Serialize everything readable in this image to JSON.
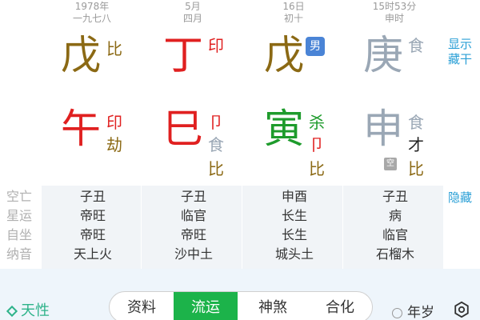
{
  "columns": [
    {
      "date1": "1978年",
      "date2": "一九七八",
      "stem": "戊",
      "stem_color": "#8b6914",
      "stem_god": "比",
      "stem_god_color": "#8b6914",
      "branch": "午",
      "branch_color": "#e02020",
      "hidden": [
        {
          "text": "印",
          "color": "#e02020"
        },
        {
          "text": "劫",
          "color": "#8b6914"
        }
      ]
    },
    {
      "date1": "5月",
      "date2": "四月",
      "stem": "丁",
      "stem_color": "#e02020",
      "stem_god": "印",
      "stem_god_color": "#e02020",
      "branch": "巳",
      "branch_color": "#e02020",
      "hidden": [
        {
          "text": "卩",
          "color": "#e02020"
        },
        {
          "text": "食",
          "color": "#9aa7b5"
        },
        {
          "text": "比",
          "color": "#8b6914"
        }
      ]
    },
    {
      "date1": "16日",
      "date2": "初十",
      "stem": "戊",
      "stem_color": "#8b6914",
      "stem_god": "男",
      "stem_god_color": "#ffffff",
      "branch": "寅",
      "branch_color": "#1e9b2c",
      "hidden": [
        {
          "text": "杀",
          "color": "#1e9b2c"
        },
        {
          "text": "卩",
          "color": "#e02020"
        },
        {
          "text": "比",
          "color": "#8b6914"
        }
      ]
    },
    {
      "date1": "15时53分",
      "date2": "申时",
      "stem": "庚",
      "stem_color": "#9aa7b5",
      "stem_god": "食",
      "stem_god_color": "#9aa7b5",
      "branch": "申",
      "branch_color": "#9aa7b5",
      "hidden": [
        {
          "text": "食",
          "color": "#9aa7b5"
        },
        {
          "text": "才",
          "color": "#222222"
        },
        {
          "text": "比",
          "color": "#8b6914"
        }
      ],
      "kong_badge": "空"
    }
  ],
  "side": {
    "show_label_1": "显示",
    "show_label_2": "藏干",
    "hide_label": "隐藏"
  },
  "table": {
    "labels": [
      "空亡",
      "星运",
      "自坐",
      "纳音"
    ],
    "rows": [
      [
        "子丑",
        "子丑",
        "申酉",
        "子丑"
      ],
      [
        "帝旺",
        "临官",
        "长生",
        "病"
      ],
      [
        "帝旺",
        "帝旺",
        "长生",
        "临官"
      ],
      [
        "天上火",
        "沙中土",
        "城头土",
        "石榴木"
      ]
    ]
  },
  "bottom": {
    "tianxing": "天性",
    "tabs": [
      "资料",
      "流运",
      "神煞",
      "合化"
    ],
    "active_tab": "流运",
    "nianhui": "年岁"
  }
}
